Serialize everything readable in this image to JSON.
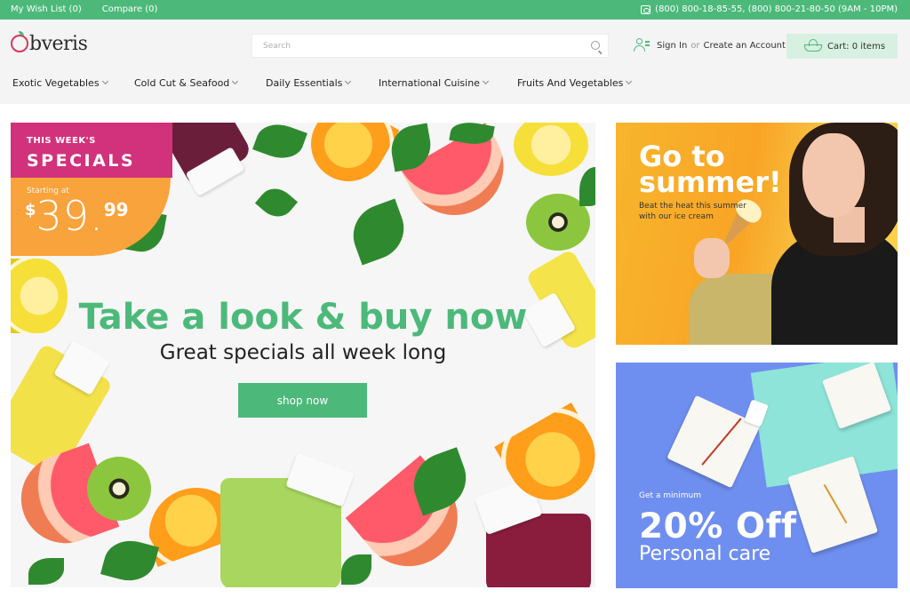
{
  "topbar": {
    "wishlist": "My Wish List (0)",
    "compare": "Compare (0)",
    "phones": "(800) 800-18-85-55, (800) 800-21-80-50 (9AM - 10PM)"
  },
  "header": {
    "logo_prefix": "O",
    "logo_text": "bveris",
    "search_placeholder": "Search",
    "sign_in": "Sign In",
    "or": "or",
    "create_account": "Create an Account",
    "cart": "Cart: 0 items"
  },
  "nav": [
    {
      "label": "Exotic Vegetables"
    },
    {
      "label": "Cold Cut & Seafood"
    },
    {
      "label": "Daily Essentials"
    },
    {
      "label": "International Cuisine"
    },
    {
      "label": "Fruits And Vegetables"
    }
  ],
  "hero": {
    "badge_line1": "THIS WEEK'S",
    "badge_line2": "SPECIALS",
    "starting_at": "Starting at",
    "currency": "$",
    "price_int": "39.",
    "price_dec": "99",
    "title": "Take a look & buy now",
    "subtitle": "Great specials all week long",
    "button": "shop now"
  },
  "banner_summer": {
    "title": "Go to summer!",
    "text": "Beat the heat this summer with our ice cream"
  },
  "banner_care": {
    "small": "Get a minimum",
    "big": "20% Off",
    "sub": "Personal care"
  },
  "colors": {
    "brand_green": "#4cb97a",
    "brand_pink": "#d2317b",
    "orange": "#f9a33c",
    "summer_yellow": "#f9a425",
    "care_blue": "#6f8ff0"
  }
}
